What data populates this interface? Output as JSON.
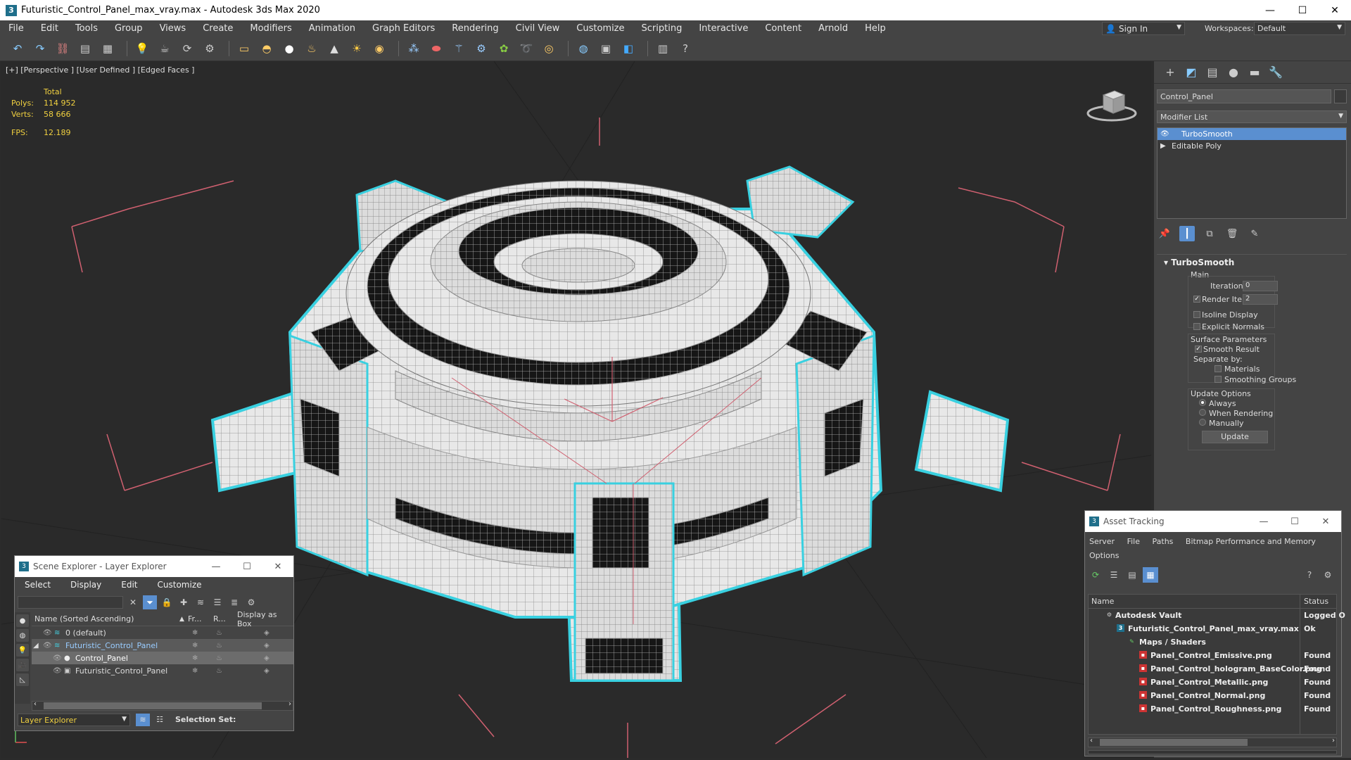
{
  "window": {
    "title": "Futuristic_Control_Panel_max_vray.max - Autodesk 3ds Max 2020",
    "minimize": "—",
    "maximize": "☐",
    "close": "✕"
  },
  "menu": [
    "File",
    "Edit",
    "Tools",
    "Group",
    "Views",
    "Create",
    "Modifiers",
    "Animation",
    "Graph Editors",
    "Rendering",
    "Civil View",
    "Customize",
    "Scripting",
    "Interactive",
    "Content",
    "Arnold",
    "Help"
  ],
  "signin": {
    "label": "Sign In"
  },
  "workspaces": {
    "label": "Workspaces:",
    "value": "Default"
  },
  "viewport": {
    "label": "[+] [Perspective ] [User Defined ] [Edged Faces ]",
    "stats": {
      "total_label": "Total",
      "polys_label": "Polys:",
      "polys_value": "114 952",
      "verts_label": "Verts:",
      "verts_value": "58 666",
      "fps_label": "FPS:",
      "fps_value": "12.189"
    }
  },
  "command_panel": {
    "object_name": "Control_Panel",
    "modifier_list": "Modifier List",
    "stack": [
      "TurboSmooth",
      "Editable Poly"
    ],
    "rollout": {
      "title": "TurboSmooth",
      "main": "Main",
      "iterations_label": "Iterations:",
      "iterations_value": "0",
      "render_iters_label": "Render Iters:",
      "render_iters_value": "2",
      "isoline": "Isoline Display",
      "explicit_normals": "Explicit Normals",
      "surface_params": "Surface Parameters",
      "smooth_result": "Smooth Result",
      "separate_by": "Separate by:",
      "materials": "Materials",
      "smoothing_groups": "Smoothing Groups",
      "update_options": "Update Options",
      "always": "Always",
      "when_rendering": "When Rendering",
      "manually": "Manually",
      "update_btn": "Update"
    }
  },
  "scene_explorer": {
    "title": "Scene Explorer - Layer Explorer",
    "menu": [
      "Select",
      "Display",
      "Edit",
      "Customize"
    ],
    "headers": {
      "name": "Name (Sorted Ascending)",
      "fr": "Fr...",
      "r": "R...",
      "box": "Display as Box"
    },
    "rows": [
      {
        "name": "0 (default)"
      },
      {
        "name": "Futuristic_Control_Panel"
      },
      {
        "name": "Control_Panel"
      },
      {
        "name": "Futuristic_Control_Panel"
      }
    ],
    "layer_dropdown": "Layer Explorer",
    "selection_set": "Selection Set:"
  },
  "asset_tracking": {
    "title": "Asset Tracking",
    "menu": [
      "Server",
      "File",
      "Paths",
      "Bitmap Performance and Memory"
    ],
    "menu2": "Options",
    "headers": {
      "name": "Name",
      "status": "Status"
    },
    "rows": [
      {
        "name": "Autodesk Vault",
        "status": "Logged O"
      },
      {
        "name": "Futuristic_Control_Panel_max_vray.max",
        "status": "Ok"
      },
      {
        "name": "Maps / Shaders",
        "status": ""
      },
      {
        "name": "Panel_Control_Emissive.png",
        "status": "Found"
      },
      {
        "name": "Panel_Control_hologram_BaseColor.png",
        "status": "Found"
      },
      {
        "name": "Panel_Control_Metallic.png",
        "status": "Found"
      },
      {
        "name": "Panel_Control_Normal.png",
        "status": "Found"
      },
      {
        "name": "Panel_Control_Roughness.png",
        "status": "Found"
      }
    ]
  }
}
